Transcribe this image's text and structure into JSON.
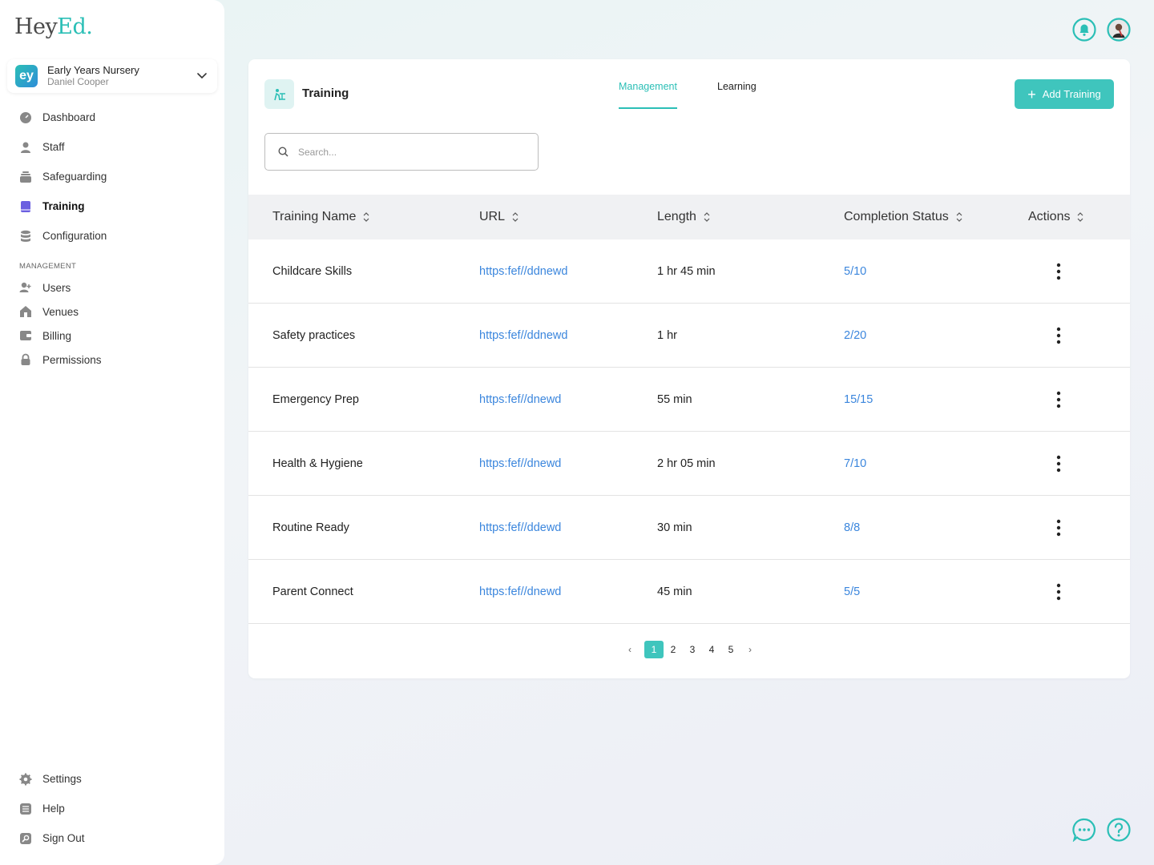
{
  "brand": {
    "logo_main": "Hey",
    "logo_accent": "Ed.",
    "accent_color": "#2bbfb6",
    "link_color": "#3b86dd"
  },
  "org": {
    "name": "Early Years Nursery",
    "user": "Daniel Cooper",
    "avatar_text": "ey"
  },
  "nav": {
    "items": [
      {
        "label": "Dashboard",
        "icon": "dashboard-icon"
      },
      {
        "label": "Staff",
        "icon": "person-icon"
      },
      {
        "label": "Safeguarding",
        "icon": "stack-icon"
      },
      {
        "label": "Training",
        "icon": "book-icon",
        "active": true
      },
      {
        "label": "Configuration",
        "icon": "database-icon"
      }
    ],
    "management_label": "MANAGEMENT",
    "management": [
      {
        "label": "Users",
        "icon": "add-user-icon"
      },
      {
        "label": "Venues",
        "icon": "home-icon"
      },
      {
        "label": "Billing",
        "icon": "wallet-icon"
      },
      {
        "label": "Permissions",
        "icon": "lock-icon"
      }
    ],
    "bottom": [
      {
        "label": "Settings",
        "icon": "gear-icon"
      },
      {
        "label": "Help",
        "icon": "list-icon"
      },
      {
        "label": "Sign Out",
        "icon": "signout-icon"
      }
    ]
  },
  "page": {
    "title": "Training",
    "tabs": [
      {
        "label": "Management",
        "active": true
      },
      {
        "label": "Learning",
        "active": false
      }
    ],
    "add_button_label": "Add Training",
    "search_placeholder": "Search..."
  },
  "table": {
    "columns": [
      "Training Name",
      "URL",
      "Length",
      "Completion Status",
      "Actions"
    ],
    "rows": [
      {
        "name": "Childcare Skills",
        "url": "https:fef//ddnewd",
        "length": "1 hr 45 min",
        "status": "5/10"
      },
      {
        "name": "Safety practices",
        "url": "https:fef//ddnewd",
        "length": "1 hr",
        "status": "2/20"
      },
      {
        "name": "Emergency Prep",
        "url": "https:fef//dnewd",
        "length": "55 min",
        "status": "15/15"
      },
      {
        "name": "Health & Hygiene",
        "url": "https:fef//dnewd",
        "length": "2 hr 05 min",
        "status": "7/10"
      },
      {
        "name": "Routine Ready",
        "url": "https:fef//ddewd",
        "length": "30 min",
        "status": "8/8"
      },
      {
        "name": "Parent Connect",
        "url": "https:fef//dnewd",
        "length": "45 min",
        "status": "5/5"
      }
    ]
  },
  "pagination": {
    "prev": "‹",
    "next": "›",
    "pages": [
      "1",
      "2",
      "3",
      "4",
      "5"
    ],
    "current": "1"
  }
}
